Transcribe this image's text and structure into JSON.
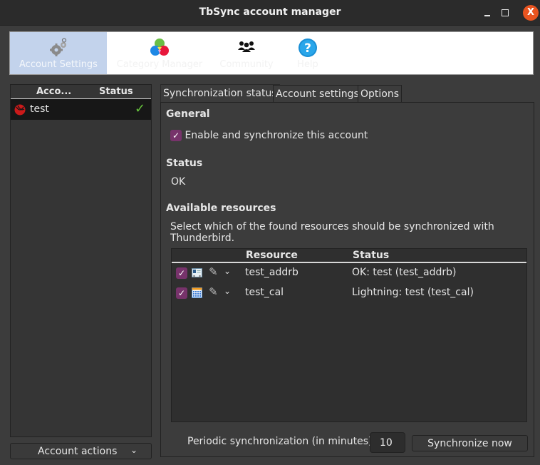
{
  "window": {
    "title": "TbSync account manager",
    "controls": {
      "minimize": "minimize",
      "maximize": "maximize",
      "close": "X"
    }
  },
  "toolbar": {
    "items": [
      {
        "label": "Account Settings",
        "icon": "gears-icon",
        "active": true
      },
      {
        "label": "Category Manager",
        "icon": "color-circles-icon",
        "active": false
      },
      {
        "label": "Community",
        "icon": "people-icon",
        "active": false
      },
      {
        "label": "Help",
        "icon": "help-icon",
        "active": false
      }
    ]
  },
  "accounts": {
    "columns": [
      "Acco...",
      "Status"
    ],
    "rows": [
      {
        "name": "test",
        "status_icon": "checkmark-icon",
        "status_color": "#66c43c"
      }
    ],
    "actions_label": "Account actions"
  },
  "tabs": [
    {
      "label": "Synchronization status",
      "active": true
    },
    {
      "label": "Account settings",
      "active": false
    },
    {
      "label": "Options",
      "active": false
    }
  ],
  "sync_status": {
    "general_title": "General",
    "enable_label": "Enable and synchronize this account",
    "enable_checked": true,
    "status_title": "Status",
    "status_value": "OK",
    "resources_title": "Available resources",
    "resources_desc_line1": "Select which of the found resources should be synchronized with",
    "resources_desc_line2": "Thunderbird.",
    "resources_columns": [
      "Resource",
      "Status"
    ],
    "resources": [
      {
        "checked": true,
        "type_icon": "address-book-icon",
        "name": "test_addrb",
        "status": "OK: test (test_addrb)"
      },
      {
        "checked": true,
        "type_icon": "calendar-icon",
        "name": "test_cal",
        "status": "Lightning: test (test_cal)"
      }
    ],
    "periodic_label": "Periodic synchronization (in minutes)",
    "periodic_value": "10",
    "sync_now_label": "Synchronize now"
  },
  "colors": {
    "accent_checkbox": "#77336b",
    "close_button": "#e95420",
    "active_toolbar": "#c3d3ec"
  }
}
